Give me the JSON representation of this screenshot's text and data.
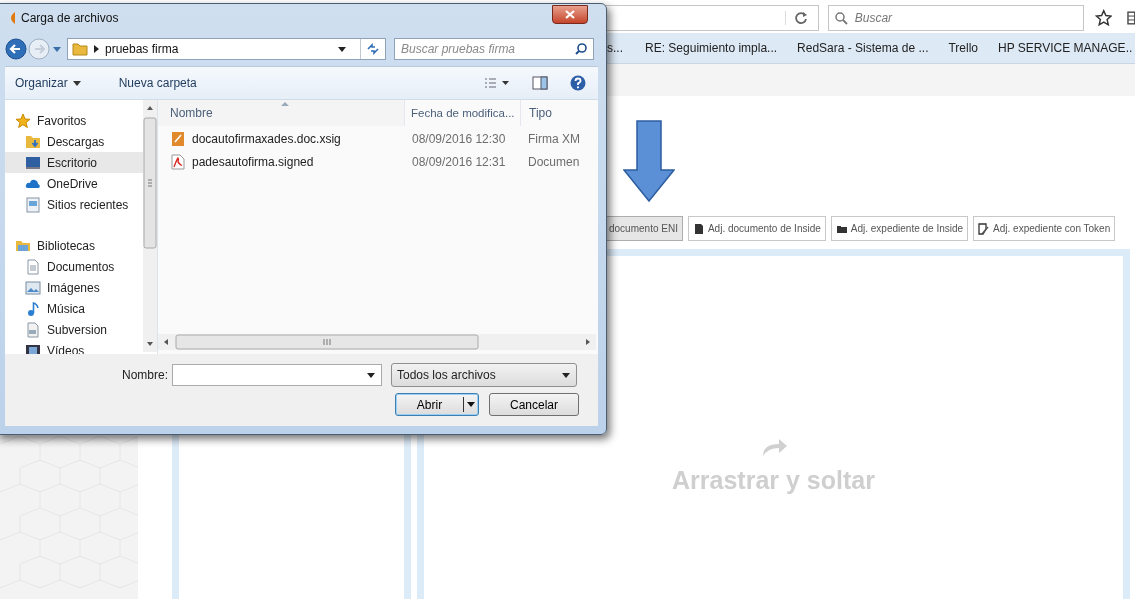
{
  "browser": {
    "search_placeholder": "Buscar",
    "bookmarks": [
      {
        "label": "s..."
      },
      {
        "label": "RE: Seguimiento impla..."
      },
      {
        "label": "RedSara - Sistema de ..."
      },
      {
        "label": "Trello"
      },
      {
        "label": "HP SERVICE MANAGE.."
      }
    ]
  },
  "page": {
    "action_buttons": [
      {
        "label": "documento ENI",
        "selected": true
      },
      {
        "label": "Adj. documento de Inside",
        "selected": false
      },
      {
        "label": "Adj. expediente de Inside",
        "selected": false
      },
      {
        "label": "Adj. expediente con Token",
        "selected": false
      }
    ],
    "drop_zone": "Arrastrar y soltar"
  },
  "dialog": {
    "title": "Carga de archivos",
    "breadcrumb": "pruebas firma",
    "search_placeholder": "Buscar pruebas firma",
    "toolbar": [
      {
        "label": "Organizar",
        "kind": "menu"
      },
      {
        "label": "Nueva carpeta",
        "kind": "button"
      }
    ],
    "sidebar": [
      {
        "label": "Favoritos",
        "children": [
          {
            "label": "Descargas",
            "selected": false
          },
          {
            "label": "Escritorio",
            "selected": true
          },
          {
            "label": "OneDrive",
            "selected": false
          },
          {
            "label": "Sitios recientes",
            "selected": false
          }
        ]
      },
      {
        "label": "Bibliotecas",
        "children": [
          {
            "label": "Documentos",
            "selected": false
          },
          {
            "label": "Imágenes",
            "selected": false
          },
          {
            "label": "Música",
            "selected": false
          },
          {
            "label": "Subversion",
            "selected": false
          },
          {
            "label": "Vídeos",
            "selected": false
          }
        ]
      }
    ],
    "columns": [
      {
        "label": "Nombre",
        "sorted": true
      },
      {
        "label": "Fecha de modifica...",
        "sorted": false
      },
      {
        "label": "Tipo",
        "sorted": false
      }
    ],
    "files": [
      {
        "name": "docautofirmaxades.doc.xsig",
        "date": "08/09/2016 12:30",
        "type": "Firma XM",
        "kind": "xsig"
      },
      {
        "name": "padesautofirma.signed",
        "date": "08/09/2016 12:31",
        "type": "Documen",
        "kind": "pdf"
      }
    ],
    "filename_label": "Nombre:",
    "filter": "Todos los archivos",
    "buttons": [
      {
        "label": "Abrir",
        "kind": "split"
      },
      {
        "label": "Cancelar",
        "kind": "plain"
      }
    ]
  }
}
